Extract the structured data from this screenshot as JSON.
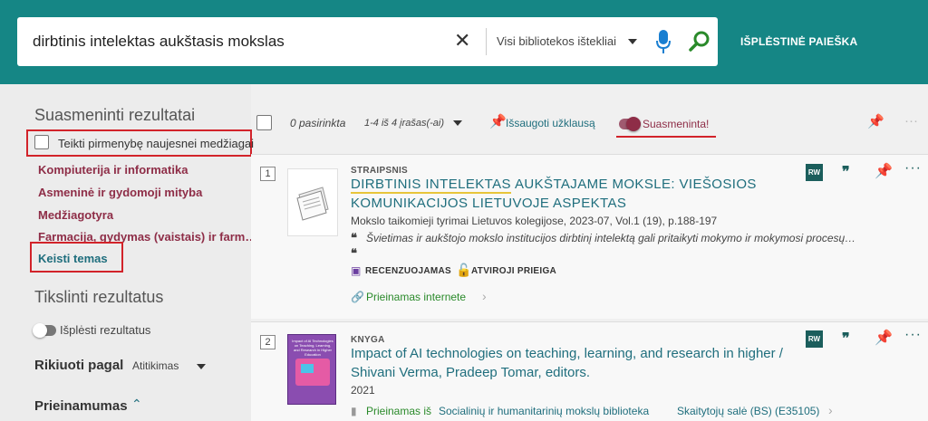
{
  "search": {
    "query": "dirbtinis intelektas aukštasis mokslas",
    "scope": "Visi bibliotekos ištekliai",
    "advanced_label": "IŠPLĖSTINĖ PAIEŠKA"
  },
  "sidebar": {
    "personalized_heading": "Suasmeninti rezultatai",
    "prefer_newer_label": "Teikti pirmenybę naujesnei medžiagai",
    "topics": [
      "Kompiuterija ir informatika",
      "Asmeninė ir gydomoji mityba",
      "Medžiagotyra",
      "Farmacija, gydymas (vaistais) ir farm…"
    ],
    "change_topics_label": "Keisti temas",
    "refine_heading": "Tikslinti rezultatus",
    "expand_label": "Išplėsti rezultatus",
    "sort_label": "Rikiuoti pagal",
    "sort_value": "Atitikimas",
    "availability_label": "Prieinamumas"
  },
  "toolbar": {
    "selected_label": "0 pasirinkta",
    "range_label": "1-4 iš 4 įrašas(-ai)",
    "save_query_label": "Išsaugoti užklausą",
    "personalized_label": "Suasmeninta!"
  },
  "results": [
    {
      "number": "1",
      "type": "STRAIPSNIS",
      "title_line1": "DIRBTINIS INTELEKTAS AUKŠTAJAME MOKSLE: VIEŠOSIOS",
      "title_line2": "KOMUNIKACIJOS LIETUVOJE ASPEKTAS",
      "source": "Mokslo taikomieji tyrimai Lietuvos kolegijose, 2023-07, Vol.1 (19), p.188-197",
      "snippet": "Švietimas ir aukštojo mokslo institucijos dirbtinį intelektą gali pritaikyti mokymo ir mokymosi procesų…",
      "badge_peer": "RECENZUOJAMAS",
      "badge_open": "ATVIROJI PRIEIGA",
      "availability": "Prieinamas internete",
      "rw": "RW"
    },
    {
      "number": "2",
      "type": "KNYGA",
      "title_line1": "Impact of AI technologies on teaching, learning, and research in higher /",
      "title_line2": "Shivani Verma, Pradeep Tomar, editors.",
      "year": "2021",
      "availability_prefix": "Prieinamas iš",
      "availability_location": "Socialinių ir humanitarinių mokslų biblioteka",
      "availability_room": "Skaitytojų salė (BS) (E35105)",
      "rw": "RW",
      "cover_text": "Impact of AI Technologies on Teaching, Learning, and Research in Higher Education"
    }
  ],
  "colors": {
    "brand": "#158685",
    "topic": "#8e2d47",
    "link": "#1f6e7d",
    "highlight": "#d2232a"
  }
}
